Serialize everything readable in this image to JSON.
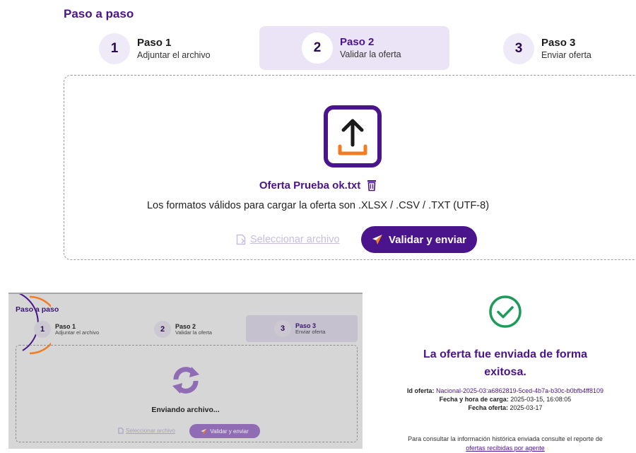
{
  "top": {
    "title": "Paso a paso",
    "steps": [
      {
        "num": "1",
        "title": "Paso 1",
        "desc": "Adjuntar el archivo"
      },
      {
        "num": "2",
        "title": "Paso 2",
        "desc": "Validar la oferta"
      },
      {
        "num": "3",
        "title": "Paso 3",
        "desc": "Enviar oferta"
      }
    ],
    "active_step": 2,
    "file_name": "Oferta Prueba ok.txt",
    "formats_text": "Los formatos válidos para cargar la oferta son .XLSX / .CSV / .TXT (UTF-8)",
    "select_label": "Seleccionar archivo",
    "validate_label": "Validar y enviar",
    "icons": {
      "upload": "upload-icon",
      "trash": "trash-icon",
      "file": "file-icon",
      "send": "send-icon"
    }
  },
  "sending": {
    "title": "Paso a paso",
    "steps": [
      {
        "num": "1",
        "title": "Paso 1",
        "desc": "Adjuntar el archivo"
      },
      {
        "num": "2",
        "title": "Paso 2",
        "desc": "Validar la oferta"
      },
      {
        "num": "3",
        "title": "Paso 3",
        "desc": "Enviar oferta"
      }
    ],
    "active_step": 3,
    "status_text": "Enviando archivo...",
    "select_label": "Seleccionar archivo",
    "validate_label": "Validar y enviar",
    "icons": {
      "sync": "sync-icon"
    }
  },
  "success": {
    "title": "La oferta fue enviada de forma exitosa.",
    "id_label": "Id oferta:",
    "id_value": "Nacional-2025-03:a6862819-5ced-4b7a-b30c-b0bfb4ff8109",
    "upload_label": "Fecha y hora de carga:",
    "upload_value": "2025-03-15, 16:08:05",
    "offer_date_label": "Fecha oferta:",
    "offer_date_value": "2025-03-17",
    "note_text": "Para consultar la información histórica enviada consulte el reporte de",
    "note_link": "ofertas recibidas por agente",
    "icons": {
      "check": "check-circle-icon"
    }
  },
  "colors": {
    "brand": "#4a148c",
    "active_step_bg": "#ebe4f6",
    "accent_orange": "#f47b20",
    "disabled_link": "#c8bde0"
  }
}
